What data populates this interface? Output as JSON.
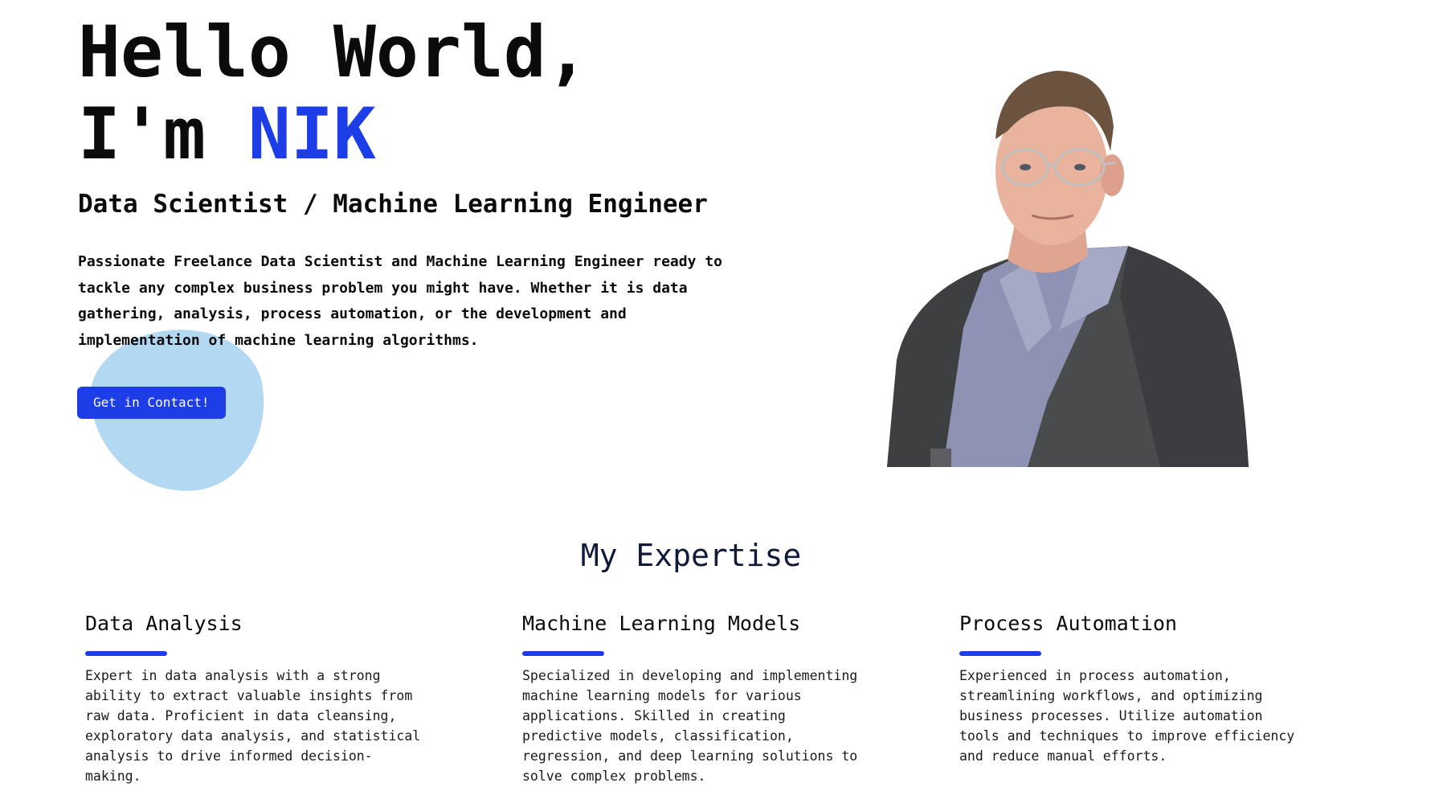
{
  "hero": {
    "title_line1": "Hello World,",
    "title_prefix": "I'm ",
    "title_name": "NIK",
    "subtitle": "Data Scientist / Machine Learning Engineer",
    "intro": "Passionate Freelance Data Scientist and Machine Learning Engineer ready to tackle any complex business problem you might have. Whether it is data gathering, analysis, process automation, or the development and implementation of machine learning algorithms.",
    "cta_label": "Get in Contact!"
  },
  "expertise": {
    "title": "My Expertise",
    "cards": [
      {
        "title": "Data Analysis",
        "text": "Expert in data analysis with a strong ability to extract valuable insights from raw data. Proficient in data cleansing, exploratory data analysis, and statistical analysis to drive informed decision-making."
      },
      {
        "title": "Machine Learning Models",
        "text": "Specialized in developing and implementing machine learning models for various applications. Skilled in creating predictive models, classification, regression, and deep learning solutions to solve complex problems."
      },
      {
        "title": "Process Automation",
        "text": "Experienced in process automation, streamlining workflows, and optimizing business processes. Utilize automation tools and techniques to improve efficiency and reduce manual efforts."
      }
    ]
  },
  "colors": {
    "accent": "#1d3ee6",
    "blob": "#b3d8f2",
    "heading_dark": "#111a3a"
  }
}
